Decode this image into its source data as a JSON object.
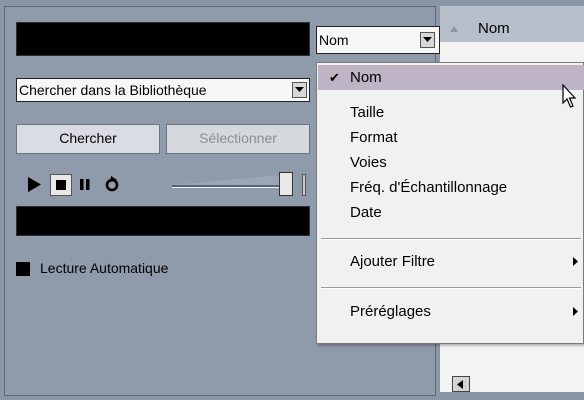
{
  "search": {
    "text_value": "",
    "scope_value": "Chercher dans la Bibliothèque",
    "search_button": "Chercher",
    "select_button": "Sélectionner"
  },
  "sort": {
    "combo_value": "Nom",
    "column_header": "Nom"
  },
  "preview": {
    "status_value": "",
    "autoplay_label": "Lecture Automatique",
    "autoplay_checked": true,
    "volume_level": 0.9
  },
  "menu": {
    "items": [
      {
        "label": "Nom",
        "checked": true
      },
      {
        "label": "Taille"
      },
      {
        "label": "Format"
      },
      {
        "label": "Voies"
      },
      {
        "label": "Fréq. d'Échantillonnage"
      },
      {
        "label": "Date"
      }
    ],
    "add_filter": "Ajouter Filtre",
    "presets": "Préréglages"
  },
  "icons": [
    "play-icon",
    "stop-icon",
    "pause-icon",
    "loop-icon",
    "chevron-down-icon",
    "sort-up-icon",
    "submenu-arrow-icon",
    "mouse-cursor-icon",
    "scroll-left-icon",
    "checkmark-icon"
  ]
}
